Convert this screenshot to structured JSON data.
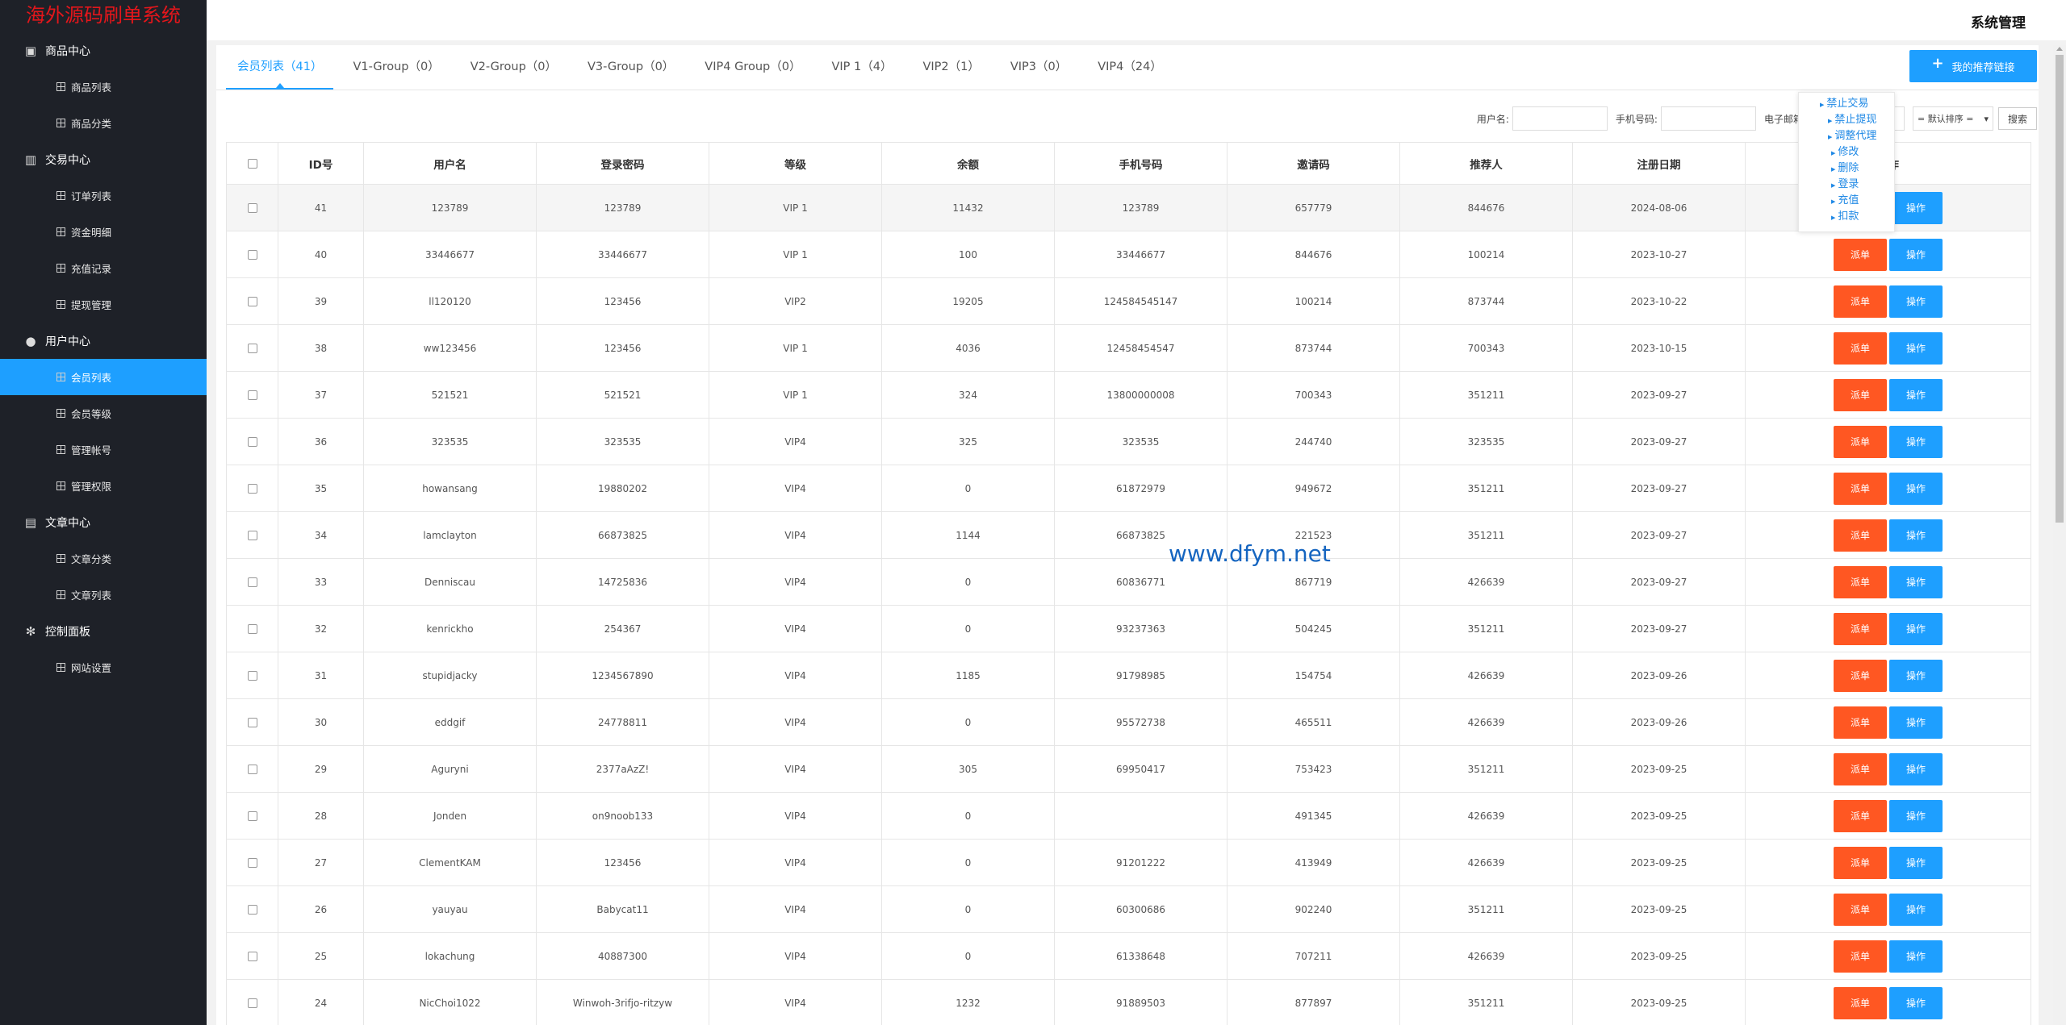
{
  "app": {
    "logo": "海外源码刷单系统",
    "header_title": "系统管理"
  },
  "sidebar": [
    {
      "label": "商品中心",
      "icon": "product-icon",
      "children": [
        "商品列表",
        "商品分类"
      ]
    },
    {
      "label": "交易中心",
      "icon": "chart-icon",
      "children": [
        "订单列表",
        "资金明细",
        "充值记录",
        "提现管理"
      ]
    },
    {
      "label": "用户中心",
      "icon": "user-icon",
      "children": [
        "会员列表",
        "会员等级",
        "管理帐号",
        "管理权限"
      ]
    },
    {
      "label": "文章中心",
      "icon": "article-icon",
      "children": [
        "文章分类",
        "文章列表"
      ]
    },
    {
      "label": "控制面板",
      "icon": "gear-icon",
      "children": [
        "网站设置"
      ]
    }
  ],
  "active_nav": "会员列表",
  "tabs": [
    "会员列表（41）",
    "V1-Group（0）",
    "V2-Group（0）",
    "V3-Group（0）",
    "VIP4 Group（0）",
    "VIP 1（4）",
    "VIP2（1）",
    "VIP3（0）",
    "VIP4（24）"
  ],
  "recommend_button": "我的推荐链接",
  "search": {
    "username_label": "用户名:",
    "phone_label": "手机号码:",
    "email_label": "电子邮箱:",
    "sort_value": "= 默认排序 =",
    "search_button": "搜索"
  },
  "table": {
    "headers": [
      "ID号",
      "用户名",
      "登录密码",
      "等级",
      "余额",
      "手机号码",
      "邀请码",
      "推荐人",
      "注册日期",
      "操作"
    ],
    "dispatch_label": "派单",
    "op_label": "操作",
    "rows": [
      [
        "41",
        "123789",
        "123789",
        "VIP 1",
        "11432",
        "123789",
        "657779",
        "844676",
        "2024-08-06"
      ],
      [
        "40",
        "33446677",
        "33446677",
        "VIP 1",
        "100",
        "33446677",
        "844676",
        "100214",
        "2023-10-27"
      ],
      [
        "39",
        "ll120120",
        "123456",
        "VIP2",
        "19205",
        "124584545147",
        "100214",
        "873744",
        "2023-10-22"
      ],
      [
        "38",
        "ww123456",
        "123456",
        "VIP 1",
        "4036",
        "12458454547",
        "873744",
        "700343",
        "2023-10-15"
      ],
      [
        "37",
        "521521",
        "521521",
        "VIP 1",
        "324",
        "13800000008",
        "700343",
        "351211",
        "2023-09-27"
      ],
      [
        "36",
        "323535",
        "323535",
        "VIP4",
        "325",
        "323535",
        "244740",
        "323535",
        "2023-09-27"
      ],
      [
        "35",
        "howansang",
        "19880202",
        "VIP4",
        "0",
        "61872979",
        "949672",
        "351211",
        "2023-09-27"
      ],
      [
        "34",
        "lamclayton",
        "66873825",
        "VIP4",
        "1144",
        "66873825",
        "221523",
        "351211",
        "2023-09-27"
      ],
      [
        "33",
        "Denniscau",
        "14725836",
        "VIP4",
        "0",
        "60836771",
        "867719",
        "426639",
        "2023-09-27"
      ],
      [
        "32",
        "kenrickho",
        "254367",
        "VIP4",
        "0",
        "93237363",
        "504245",
        "351211",
        "2023-09-27"
      ],
      [
        "31",
        "stupidjacky",
        "1234567890",
        "VIP4",
        "1185",
        "91798985",
        "154754",
        "426639",
        "2023-09-26"
      ],
      [
        "30",
        "eddgif",
        "24778811",
        "VIP4",
        "0",
        "95572738",
        "465511",
        "426639",
        "2023-09-26"
      ],
      [
        "29",
        "Aguryni",
        "2377aAzZ!",
        "VIP4",
        "305",
        "69950417",
        "753423",
        "351211",
        "2023-09-25"
      ],
      [
        "28",
        "Jonden",
        "on9noob133",
        "VIP4",
        "0",
        "",
        "491345",
        "426639",
        "2023-09-25"
      ],
      [
        "27",
        "ClementKAM",
        "123456",
        "VIP4",
        "0",
        "91201222",
        "413949",
        "426639",
        "2023-09-25"
      ],
      [
        "26",
        "yauyau",
        "Babycat11",
        "VIP4",
        "0",
        "60300686",
        "902240",
        "351211",
        "2023-09-25"
      ],
      [
        "25",
        "lokachung",
        "40887300",
        "VIP4",
        "0",
        "61338648",
        "707211",
        "426639",
        "2023-09-25"
      ],
      [
        "24",
        "NicChoi1022",
        "Winwoh-3rifjo-ritzyw",
        "VIP4",
        "1232",
        "91889503",
        "877897",
        "351211",
        "2023-09-25"
      ]
    ]
  },
  "popup_menu": [
    "禁止交易",
    "禁止提现",
    "调整代理",
    "修改",
    "删除",
    "登录",
    "充值",
    "扣款"
  ],
  "watermark": "www.dfym.net",
  "colors": {
    "accent": "#1e9fff",
    "dispatch": "#ff5722",
    "logo": "#e4161b",
    "sidebar": "#1e2128"
  }
}
